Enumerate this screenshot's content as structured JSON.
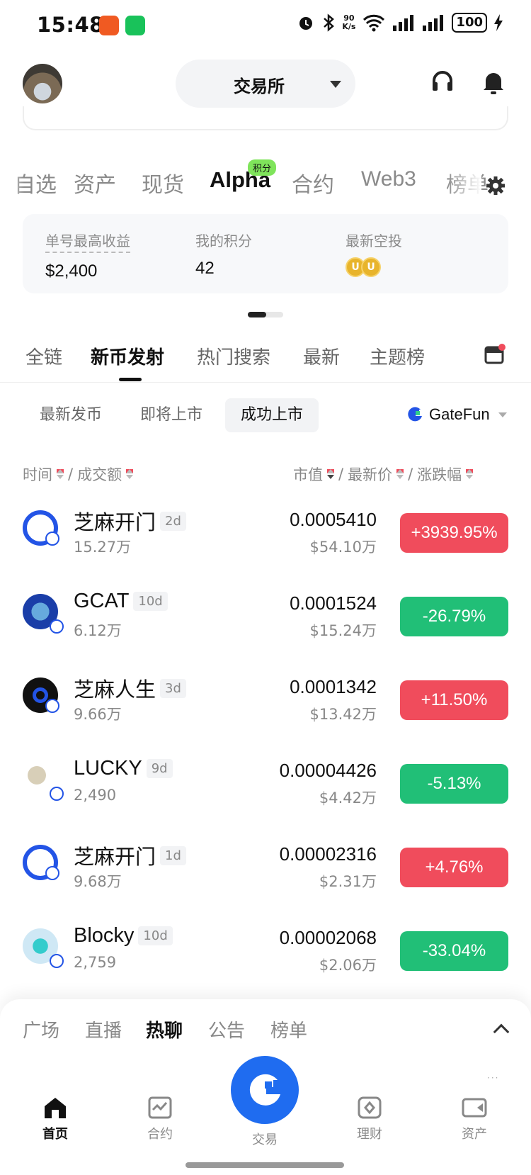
{
  "status_bar": {
    "time": "15:48",
    "net_speed_top": "90",
    "net_speed_bottom": "K/s",
    "battery": "100"
  },
  "header": {
    "exchange_label": "交易所"
  },
  "main_tabs": {
    "items": [
      "自选",
      "资产",
      "现货",
      "Alpha",
      "合约",
      "Web3",
      "榜单"
    ],
    "active": "Alpha",
    "badge": "积分"
  },
  "stats": {
    "max_profit_label": "单号最高收益",
    "max_profit_value": "$2,400",
    "points_label": "我的积分",
    "points_value": "42",
    "airdrop_label": "最新空投"
  },
  "sub_tabs": {
    "items": [
      "全链",
      "新币发射",
      "热门搜索",
      "最新",
      "主题榜"
    ],
    "active": "新币发射"
  },
  "filters": {
    "items": [
      "最新发币",
      "即将上市",
      "成功上市"
    ],
    "active": "成功上市",
    "platform": "GateFun"
  },
  "columns": {
    "left": "时间",
    "sep1": "/",
    "left2": "成交额",
    "right1": "市值",
    "sep2": "/",
    "right2": "最新价",
    "sep3": "/",
    "right3": "涨跌幅"
  },
  "rows": [
    {
      "name": "芝麻开门",
      "age": "2d",
      "volume": "15.27万",
      "price": "0.0005410",
      "mcap": "$54.10万",
      "change": "+3939.95%",
      "direction": "up"
    },
    {
      "name": "GCAT",
      "age": "10d",
      "volume": "6.12万",
      "price": "0.0001524",
      "mcap": "$15.24万",
      "change": "-26.79%",
      "direction": "down"
    },
    {
      "name": "芝麻人生",
      "age": "3d",
      "volume": "9.66万",
      "price": "0.0001342",
      "mcap": "$13.42万",
      "change": "+11.50%",
      "direction": "up"
    },
    {
      "name": "LUCKY",
      "age": "9d",
      "volume": "2,490",
      "price": "0.00004426",
      "mcap": "$4.42万",
      "change": "-5.13%",
      "direction": "down"
    },
    {
      "name": "芝麻开门",
      "age": "1d",
      "volume": "9.68万",
      "price": "0.00002316",
      "mcap": "$2.31万",
      "change": "+4.76%",
      "direction": "up"
    },
    {
      "name": "Blocky",
      "age": "10d",
      "volume": "2,759",
      "price": "0.00002068",
      "mcap": "$2.06万",
      "change": "-33.04%",
      "direction": "down"
    }
  ],
  "panel_tabs": {
    "items": [
      "广场",
      "直播",
      "热聊",
      "公告",
      "榜单"
    ],
    "active": "热聊"
  },
  "bottom_nav": {
    "home": "首页",
    "futures": "合约",
    "trade": "交易",
    "finance": "理财",
    "assets": "资产"
  },
  "colors": {
    "up": "#f04c5c",
    "down": "#21bf77",
    "brand": "#1f6cf0",
    "badge": "#7fe45b"
  }
}
